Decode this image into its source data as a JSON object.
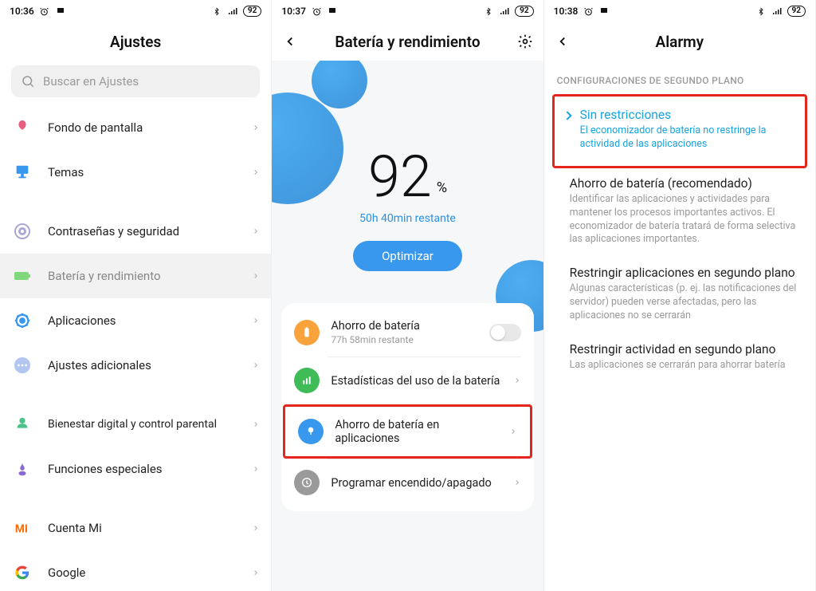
{
  "phone1": {
    "time": "10:36",
    "battery": "92",
    "title": "Ajustes",
    "search_placeholder": "Buscar en Ajustes",
    "items": {
      "wallpaper": "Fondo de pantalla",
      "themes": "Temas",
      "passwords": "Contraseñas y seguridad",
      "battery": "Batería y rendimiento",
      "apps": "Aplicaciones",
      "additional": "Ajustes adicionales",
      "wellbeing": "Bienestar digital y control parental",
      "special": "Funciones especiales",
      "mi_account": "Cuenta Mi",
      "google": "Google"
    }
  },
  "phone2": {
    "time": "10:37",
    "battery": "92",
    "title": "Batería y rendimiento",
    "percent": "92",
    "percent_symbol": "%",
    "time_remaining": "50h 40min restante",
    "optimize": "Optimizar",
    "card": {
      "saver_title": "Ahorro de batería",
      "saver_sub": "77h 58min restante",
      "stats": "Estadísticas del uso de la batería",
      "app_saver": "Ahorro de batería en aplicaciones",
      "schedule": "Programar encendido/apagado"
    }
  },
  "phone3": {
    "time": "10:38",
    "battery": "92",
    "title": "Alarmy",
    "section": "CONFIGURACIONES DE SEGUNDO PLANO",
    "opts": {
      "none_title": "Sin restricciones",
      "none_desc": "El economizador de batería no restringe la actividad de las aplicaciones",
      "rec_title": "Ahorro de batería (recomendado)",
      "rec_desc": "Identificar las aplicaciones y actividades para mantener los procesos importantes activos. El economizador de batería tratará de forma selectiva las aplicaciones importantes.",
      "restrict_bg_title": "Restringir aplicaciones en segundo plano",
      "restrict_bg_desc": "Algunas características (p. ej. las notificaciones del servidor) pueden verse afectadas, pero las aplicaciones no se cerrarán",
      "restrict_act_title": "Restringir actividad en segundo plano",
      "restrict_act_desc": "Las aplicaciones se cerrarán para ahorrar batería"
    }
  }
}
